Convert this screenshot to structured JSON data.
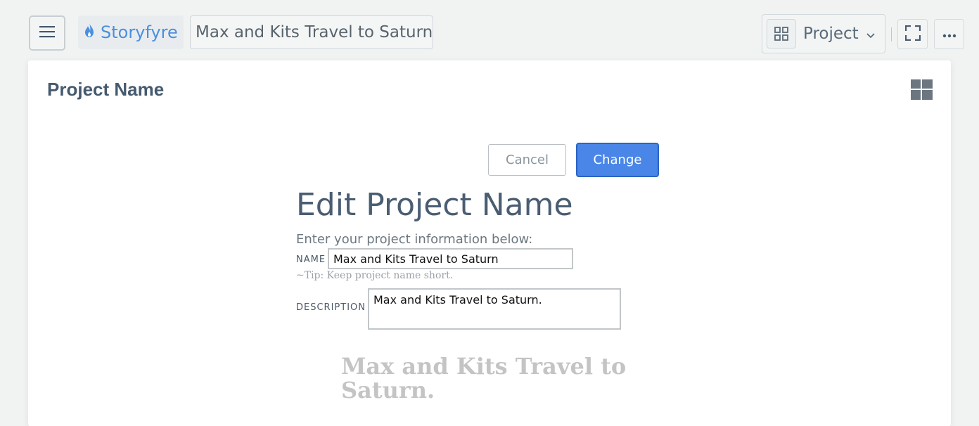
{
  "header": {
    "brand_name": "Storyfyre",
    "project_title": "Max and Kits Travel to Saturn",
    "view_select_label": "Project"
  },
  "card": {
    "title": "Project Name"
  },
  "form": {
    "cancel_label": "Cancel",
    "change_label": "Change",
    "heading": "Edit Project Name",
    "intro": "Enter your project information below:",
    "name_label": "NAME",
    "name_value": "Max and Kits Travel to Saturn",
    "tip": "~Tip: Keep project name short.",
    "description_label": "DESCRIPTION",
    "description_value": "Max and Kits Travel to Saturn."
  },
  "preview": {
    "text": "Max and Kits Travel to Saturn."
  },
  "icons": {
    "menu": "hamburger-icon",
    "brand": "flame-icon",
    "view": "grid-icon",
    "chevron": "chevron-down-icon",
    "fullscreen": "fullscreen-icon",
    "more": "ellipsis-icon",
    "layout": "layout-grid-icon"
  },
  "colors": {
    "accent": "#4a86e8",
    "brand": "#4a8fe0",
    "heading": "#4a5d72"
  }
}
